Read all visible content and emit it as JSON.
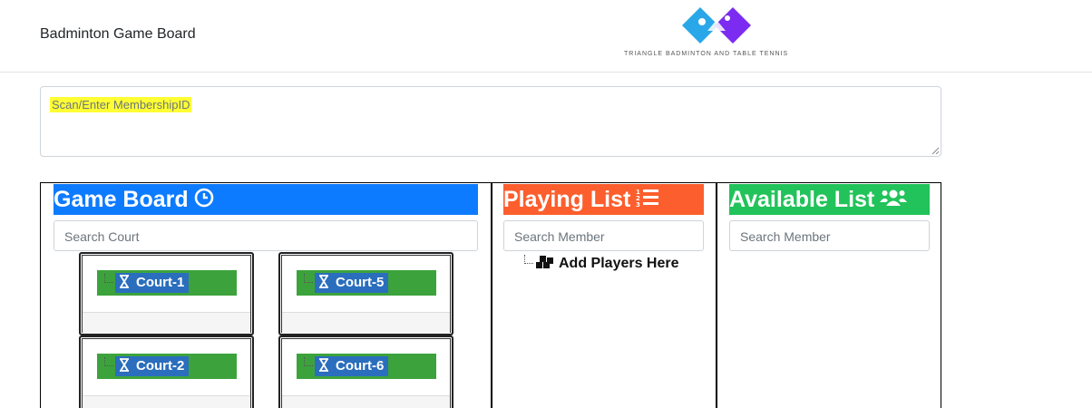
{
  "header": {
    "brand": "Badminton Game Board",
    "logo_text": "TRIANGLE BADMINTON AND TABLE TENNIS"
  },
  "scan": {
    "placeholder": "Scan/Enter MembershipID"
  },
  "game_board": {
    "title": "Game Board",
    "title_icon": "clock-icon",
    "color": "#0d7bff",
    "search_placeholder": "Search Court",
    "courts": [
      {
        "label": "Court-1"
      },
      {
        "label": "Court-5"
      },
      {
        "label": "Court-2"
      },
      {
        "label": "Court-6"
      }
    ],
    "court_icon": "hourglass-icon"
  },
  "playing_list": {
    "title": "Playing List",
    "title_icon": "ordered-list-icon",
    "color": "#fd5e2d",
    "search_placeholder": "Search Member",
    "add_label": "Add Players Here",
    "add_icon": "cubes-icon"
  },
  "available_list": {
    "title": "Available List",
    "title_icon": "users-icon",
    "color": "#21c35a",
    "search_placeholder": "Search Member"
  }
}
